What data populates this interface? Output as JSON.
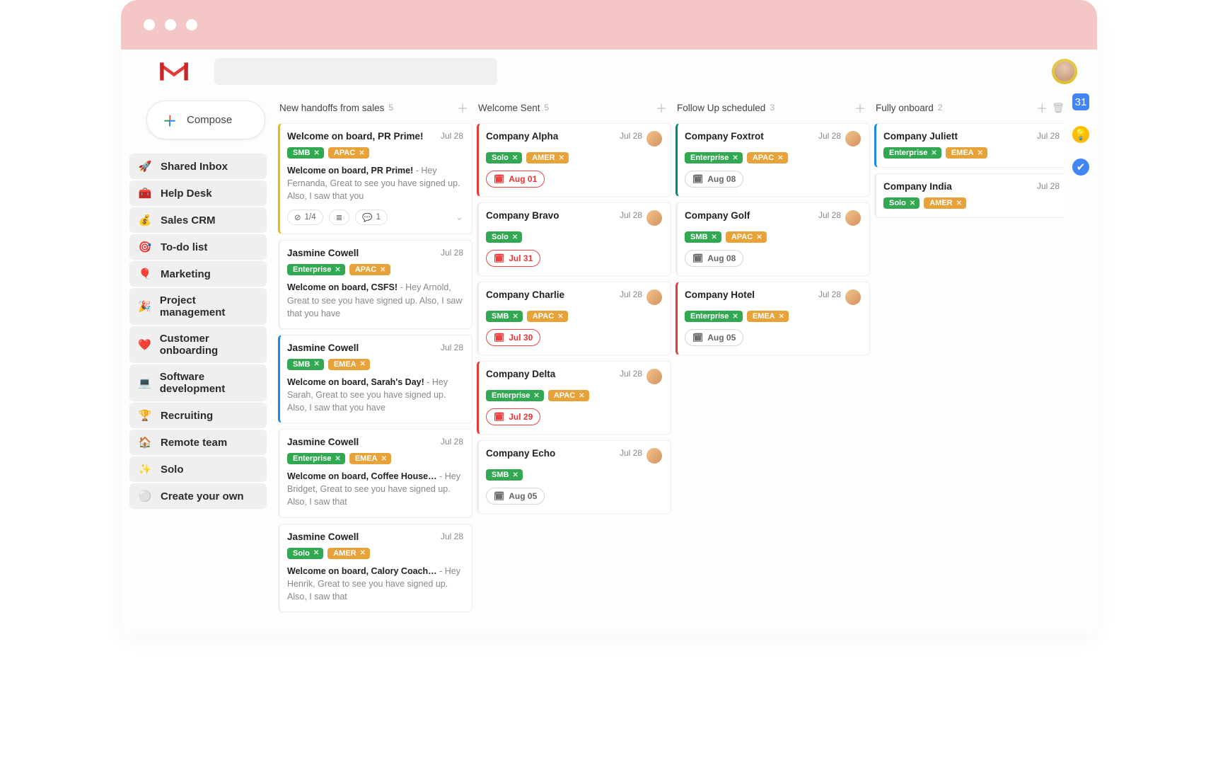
{
  "compose_label": "Compose",
  "search_placeholder": "",
  "sidebar": {
    "items": [
      {
        "emoji": "🚀",
        "label": "Shared Inbox"
      },
      {
        "emoji": "🧰",
        "label": "Help Desk"
      },
      {
        "emoji": "💰",
        "label": "Sales CRM"
      },
      {
        "emoji": "🎯",
        "label": "To-do list"
      },
      {
        "emoji": "🎈",
        "label": "Marketing"
      },
      {
        "emoji": "🎉",
        "label": "Project management"
      },
      {
        "emoji": "❤️",
        "label": "Customer onboarding"
      },
      {
        "emoji": "💻",
        "label": "Software development"
      },
      {
        "emoji": "🏆",
        "label": "Recruiting"
      },
      {
        "emoji": "🏠",
        "label": "Remote team"
      },
      {
        "emoji": "✨",
        "label": "Solo"
      },
      {
        "emoji": "⚪",
        "label": "Create your own"
      }
    ]
  },
  "columns": [
    {
      "title": "New handoffs from sales",
      "count": "5",
      "show_trash": false,
      "cards": [
        {
          "title": "Welcome on board, PR Prime!",
          "date": "Jul 28",
          "accent": "yellow",
          "tags": [
            "SMB",
            "APAC"
          ],
          "subject": "Welcome on board, PR Prime!",
          "preview": " - Hey Fernanda, Great to see you have signed up. Also, I saw that you",
          "footer": {
            "progress": "1/4",
            "comments": "1",
            "show_desc": true,
            "expand": true
          }
        },
        {
          "title": "Jasmine Cowell",
          "date": "Jul 28",
          "accent": "none",
          "tags": [
            "Enterprise",
            "APAC"
          ],
          "subject": "Welcome on board, CSFS!",
          "preview": " - Hey Arnold, Great to see you have signed up. Also, I saw that you have"
        },
        {
          "title": "Jasmine Cowell",
          "date": "Jul 28",
          "accent": "blue",
          "tags": [
            "SMB",
            "EMEA"
          ],
          "subject": "Welcome on board, Sarah's Day!",
          "preview": " - Hey Sarah, Great to see you have signed up. Also, I saw that you have"
        },
        {
          "title": "Jasmine Cowell",
          "date": "Jul 28",
          "accent": "none",
          "tags": [
            "Enterprise",
            "EMEA"
          ],
          "subject": "Welcome on board, Coffee House…",
          "preview": " - Hey Bridget, Great to see you have signed up. Also, I saw that"
        },
        {
          "title": "Jasmine Cowell",
          "date": "Jul 28",
          "accent": "none",
          "tags": [
            "Solo",
            "AMER"
          ],
          "subject": "Welcome on board, Calory Coach…",
          "preview": " - Hey Henrik, Great to see you have signed up. Also, I saw that"
        }
      ]
    },
    {
      "title": "Welcome Sent",
      "count": "5",
      "show_trash": false,
      "cards": [
        {
          "title": "Company Alpha",
          "date": "Jul 28",
          "accent": "red",
          "avatar": true,
          "tags": [
            "Solo",
            "AMER"
          ],
          "date_chip": {
            "label": "Aug 01",
            "style": "red"
          }
        },
        {
          "title": "Company Bravo",
          "date": "Jul 28",
          "accent": "none",
          "avatar": true,
          "tags": [
            "Solo"
          ],
          "date_chip": {
            "label": "Jul 31",
            "style": "red"
          }
        },
        {
          "title": "Company Charlie",
          "date": "Jul 28",
          "accent": "none",
          "avatar": true,
          "tags": [
            "SMB",
            "APAC"
          ],
          "date_chip": {
            "label": "Jul 30",
            "style": "red"
          }
        },
        {
          "title": "Company Delta",
          "date": "Jul 28",
          "accent": "red",
          "avatar": true,
          "tags": [
            "Enterprise",
            "APAC"
          ],
          "date_chip": {
            "label": "Jul 29",
            "style": "red"
          }
        },
        {
          "title": "Company Echo",
          "date": "Jul 28",
          "accent": "none",
          "avatar": true,
          "tags": [
            "SMB"
          ],
          "date_chip": {
            "label": "Aug 05",
            "style": "grey"
          }
        }
      ]
    },
    {
      "title": "Follow Up scheduled",
      "count": "3",
      "show_trash": false,
      "cards": [
        {
          "title": "Company Foxtrot",
          "date": "Jul 28",
          "accent": "teal",
          "avatar": true,
          "tags": [
            "Enterprise",
            "APAC"
          ],
          "date_chip": {
            "label": "Aug 08",
            "style": "grey"
          }
        },
        {
          "title": "Company Golf",
          "date": "Jul 28",
          "accent": "none",
          "avatar": true,
          "tags": [
            "SMB",
            "APAC"
          ],
          "date_chip": {
            "label": "Aug 08",
            "style": "grey"
          }
        },
        {
          "title": "Company Hotel",
          "date": "Jul 28",
          "accent": "red",
          "avatar": true,
          "tags": [
            "Enterprise",
            "EMEA"
          ],
          "date_chip": {
            "label": "Aug 05",
            "style": "grey"
          }
        }
      ]
    },
    {
      "title": "Fully onboard",
      "count": "2",
      "show_trash": true,
      "cards": [
        {
          "title": "Company Juliett",
          "date": "Jul 28",
          "accent": "blue",
          "tags": [
            "Enterprise",
            "EMEA"
          ]
        },
        {
          "title": "Company India",
          "date": "Jul 28",
          "accent": "none",
          "tags": [
            "Solo",
            "AMER"
          ]
        }
      ]
    }
  ]
}
